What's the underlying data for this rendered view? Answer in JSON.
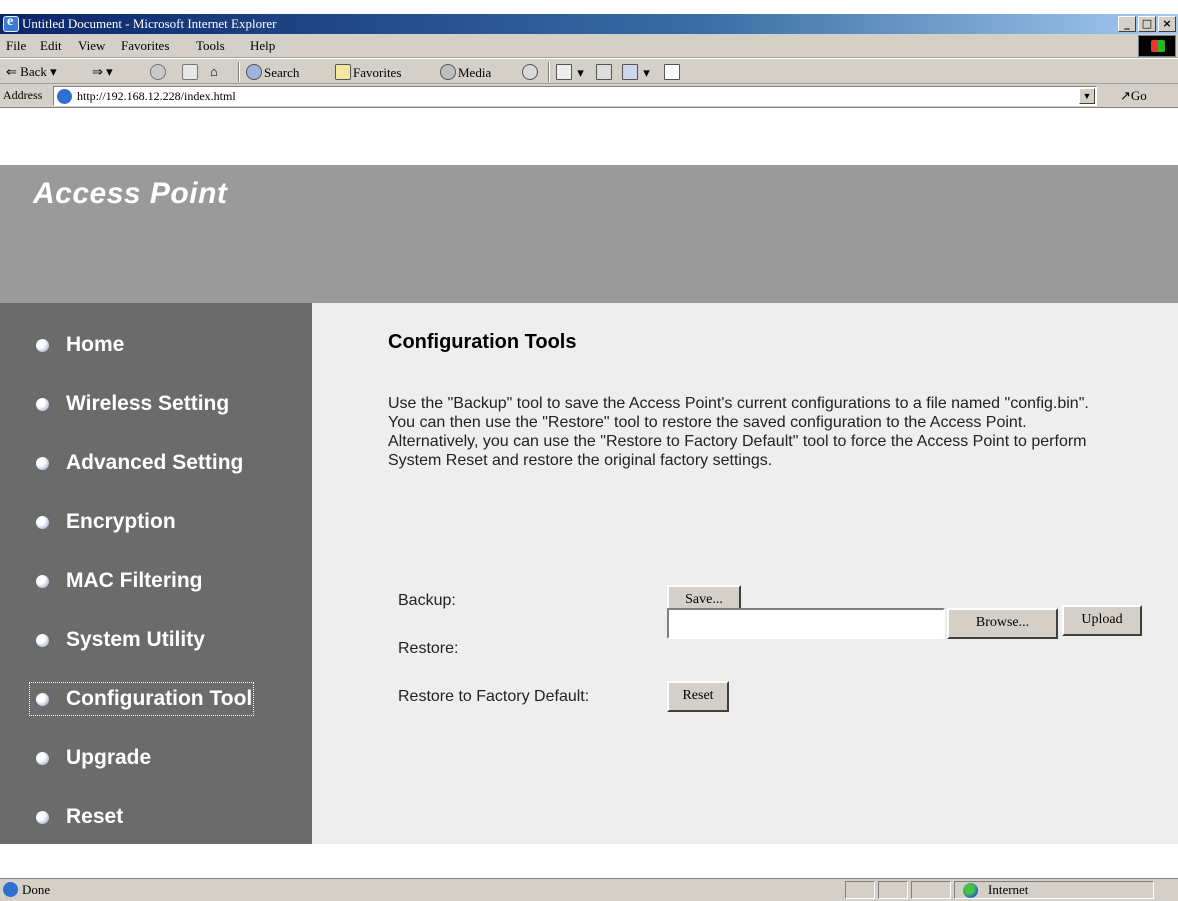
{
  "window": {
    "title": "Untitled Document - Microsoft Internet Explorer",
    "min_label": "_",
    "max_label": "□",
    "close_label": "×"
  },
  "menu": {
    "file": "File",
    "edit": "Edit",
    "view": "View",
    "favorites": "Favorites",
    "tools": "Tools",
    "help": "Help"
  },
  "toolbar": {
    "back": "Back",
    "search": "Search",
    "favorites": "Favorites",
    "media": "Media"
  },
  "address": {
    "label": "Address",
    "url": "http://192.168.12.228/index.html",
    "go": "Go"
  },
  "page": {
    "banner_title": "Access Point",
    "nav": [
      {
        "label": "Home"
      },
      {
        "label": "Wireless Setting"
      },
      {
        "label": "Advanced Setting"
      },
      {
        "label": "Encryption"
      },
      {
        "label": "MAC Filtering"
      },
      {
        "label": "System Utility"
      },
      {
        "label": "Configuration Tool",
        "active": true
      },
      {
        "label": "Upgrade"
      },
      {
        "label": "Reset"
      }
    ],
    "heading": "Configuration Tools",
    "description": "Use the \"Backup\" tool to save the Access Point's current configurations to a file named \"config.bin\". You can then use the \"Restore\" tool to restore the saved configuration to the Access Point. Alternatively, you can use the \"Restore to Factory Default\" tool to force the Access Point to perform System Reset and restore the original factory settings.",
    "form": {
      "backup_label": "Backup:",
      "save_button": "Save...",
      "restore_label": "Restore:",
      "browse_button": "Browse...",
      "upload_button": "Upload",
      "factory_label": "Restore to Factory Default:",
      "reset_button": "Reset"
    }
  },
  "status": {
    "text": "Done",
    "zone": "Internet"
  },
  "colors": {
    "banner": "#9a9a9a",
    "sidebar": "#6b6b6b",
    "main": "#eeeeee"
  }
}
